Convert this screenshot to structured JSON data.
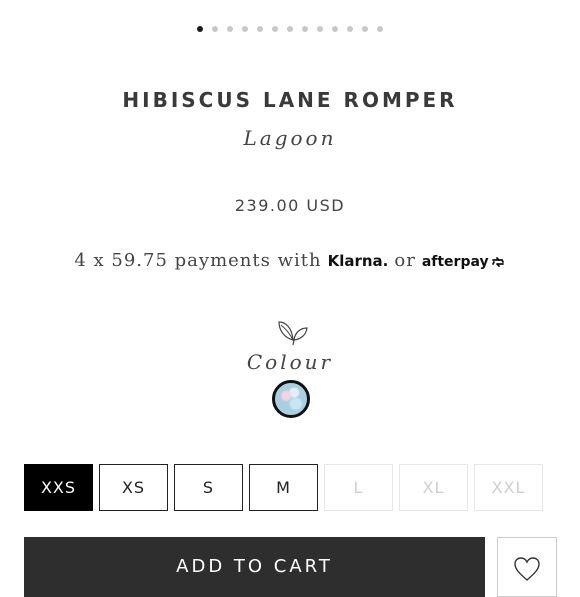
{
  "carousel": {
    "total_slides": 13,
    "active_index": 0
  },
  "product": {
    "title": "HIBISCUS LANE ROMPER",
    "variant_name": "Lagoon",
    "price": "239.00 USD"
  },
  "installments": {
    "text": "4 x 59.75 payments with",
    "klarna_label": "Klarna.",
    "or_label": "or",
    "afterpay_label": "afterpay"
  },
  "colour": {
    "label": "Colour",
    "swatch_icon": "leaf-icon",
    "selected_swatch": "lagoon"
  },
  "sizes": [
    {
      "label": "XXS",
      "selected": true,
      "available": true
    },
    {
      "label": "XS",
      "selected": false,
      "available": true
    },
    {
      "label": "S",
      "selected": false,
      "available": true
    },
    {
      "label": "M",
      "selected": false,
      "available": true
    },
    {
      "label": "L",
      "selected": false,
      "available": false
    },
    {
      "label": "XL",
      "selected": false,
      "available": false
    },
    {
      "label": "XXL",
      "selected": false,
      "available": false
    }
  ],
  "actions": {
    "add_to_cart_label": "ADD TO CART",
    "wishlist_icon": "heart-icon"
  },
  "colors": {
    "selected_size_bg": "#000000",
    "button_bg": "#2e2e2e",
    "active_dot": "#1a1a1a",
    "inactive_dot": "#c8c8c8"
  }
}
